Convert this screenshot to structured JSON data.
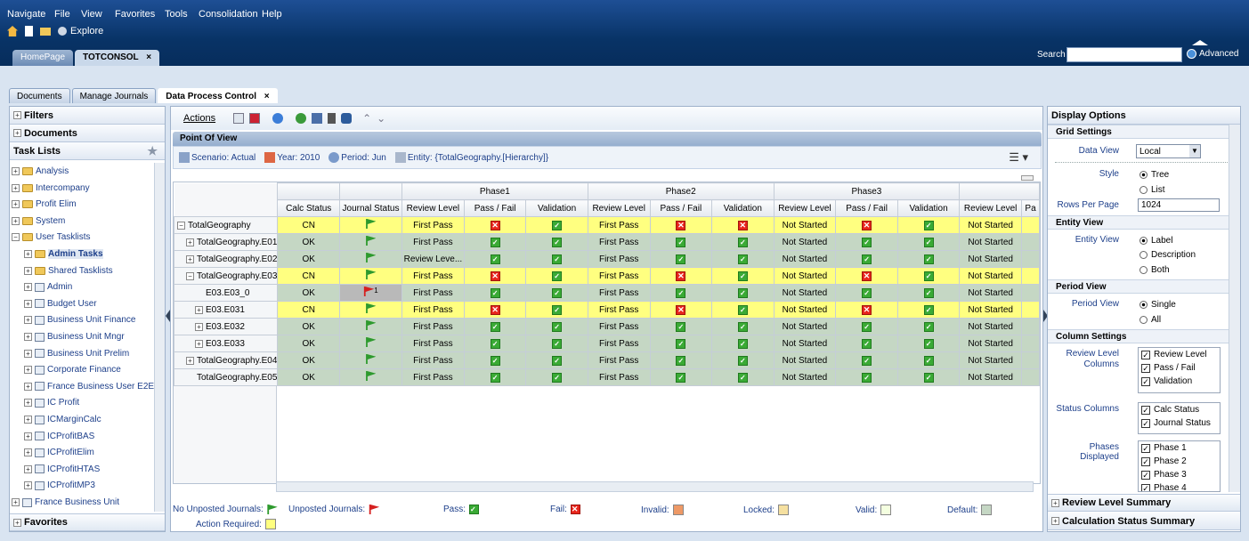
{
  "menu": [
    "Navigate",
    "File",
    "View",
    "Favorites",
    "Tools",
    "Consolidation",
    "Help"
  ],
  "toolbar": {
    "explore": "Explore"
  },
  "main_tabs": {
    "home": "HomePage",
    "active": "TOTCONSOL",
    "close": "×"
  },
  "search": {
    "label": "Search",
    "advanced": "Advanced"
  },
  "section_tabs": {
    "documents": "Documents",
    "manage": "Manage Journals",
    "active": "Data Process Control",
    "close": "×"
  },
  "left": {
    "filters": "Filters",
    "documents": "Documents",
    "task_lists": "Task Lists",
    "favorites": "Favorites",
    "tree": [
      {
        "label": "Analysis",
        "type": "folder",
        "level": 0
      },
      {
        "label": "Intercompany",
        "type": "folder",
        "level": 0
      },
      {
        "label": "Profit Elim",
        "type": "folder",
        "level": 0
      },
      {
        "label": "System",
        "type": "folder",
        "level": 0
      },
      {
        "label": "User Tasklists",
        "type": "folder",
        "level": 0
      },
      {
        "label": "Admin Tasks",
        "type": "folder",
        "level": 1
      },
      {
        "label": "Shared Tasklists",
        "type": "folder",
        "level": 1
      },
      {
        "label": "Admin",
        "type": "doc",
        "level": 1
      },
      {
        "label": "Budget User",
        "type": "doc",
        "level": 1
      },
      {
        "label": "Business Unit Finance",
        "type": "doc",
        "level": 1
      },
      {
        "label": "Business Unit Mngr",
        "type": "doc",
        "level": 1
      },
      {
        "label": "Business Unit Prelim",
        "type": "doc",
        "level": 1
      },
      {
        "label": "Corporate Finance",
        "type": "doc",
        "level": 1
      },
      {
        "label": "France Business User E2E",
        "type": "doc",
        "level": 1
      },
      {
        "label": "IC Profit",
        "type": "doc",
        "level": 1
      },
      {
        "label": "ICMarginCalc",
        "type": "doc",
        "level": 1
      },
      {
        "label": "ICProfitBAS",
        "type": "doc",
        "level": 1
      },
      {
        "label": "ICProfitElim",
        "type": "doc",
        "level": 1
      },
      {
        "label": "ICProfitHTAS",
        "type": "doc",
        "level": 1
      },
      {
        "label": "ICProfitMP3",
        "type": "doc",
        "level": 1
      },
      {
        "label": "France Business Unit",
        "type": "doc",
        "level": 0
      }
    ]
  },
  "center": {
    "actions": "Actions",
    "pov_title": "Point Of View",
    "pov": {
      "scenario": "Scenario: Actual",
      "year": "Year: 2010",
      "period": "Period: Jun",
      "entity": "Entity: {TotalGeography.[Hierarchy]}"
    },
    "phases": [
      "Phase1",
      "Phase2",
      "Phase3"
    ],
    "columns": {
      "calc": "Calc Status",
      "journal": "Journal Status",
      "review": "Review Level",
      "passfail": "Pass / Fail",
      "validation": "Validation",
      "partial": "Pa"
    },
    "rows": [
      {
        "name": "TotalGeography",
        "exp": "−",
        "ind": 0,
        "calc": "CN",
        "flag": "green",
        "color": "y",
        "p1": [
          "First Pass",
          "fail",
          "pass"
        ],
        "p2": [
          "First Pass",
          "fail",
          "fail"
        ],
        "p3": [
          "Not Started",
          "fail",
          "pass"
        ],
        "p4": "Not Started"
      },
      {
        "name": "TotalGeography.E01",
        "exp": "+",
        "ind": 1,
        "calc": "OK",
        "flag": "green",
        "color": "g",
        "p1": [
          "First Pass",
          "pass",
          "pass"
        ],
        "p2": [
          "First Pass",
          "pass",
          "pass"
        ],
        "p3": [
          "Not Started",
          "pass",
          "pass"
        ],
        "p4": "Not Started"
      },
      {
        "name": "TotalGeography.E02",
        "exp": "+",
        "ind": 1,
        "calc": "OK",
        "flag": "green",
        "color": "g",
        "p1": [
          "Review Leve...",
          "pass",
          "pass"
        ],
        "p2": [
          "First Pass",
          "pass",
          "pass"
        ],
        "p3": [
          "Not Started",
          "pass",
          "pass"
        ],
        "p4": "Not Started"
      },
      {
        "name": "TotalGeography.E03",
        "exp": "−",
        "ind": 1,
        "calc": "CN",
        "flag": "green",
        "color": "y",
        "p1": [
          "First Pass",
          "fail",
          "pass"
        ],
        "p2": [
          "First Pass",
          "fail",
          "pass"
        ],
        "p3": [
          "Not Started",
          "fail",
          "pass"
        ],
        "p4": "Not Started"
      },
      {
        "name": "E03.E03_0",
        "exp": "",
        "ind": 2,
        "calc": "OK",
        "flag": "red",
        "flag_count": "1",
        "color": "g",
        "p1": [
          "First Pass",
          "pass",
          "pass"
        ],
        "p2": [
          "First Pass",
          "pass",
          "pass"
        ],
        "p3": [
          "Not Started",
          "pass",
          "pass"
        ],
        "p4": "Not Started"
      },
      {
        "name": "E03.E031",
        "exp": "+",
        "ind": 2,
        "calc": "CN",
        "flag": "green",
        "color": "y",
        "p1": [
          "First Pass",
          "fail",
          "pass"
        ],
        "p2": [
          "First Pass",
          "fail",
          "pass"
        ],
        "p3": [
          "Not Started",
          "fail",
          "pass"
        ],
        "p4": "Not Started"
      },
      {
        "name": "E03.E032",
        "exp": "+",
        "ind": 2,
        "calc": "OK",
        "flag": "green",
        "color": "g",
        "p1": [
          "First Pass",
          "pass",
          "pass"
        ],
        "p2": [
          "First Pass",
          "pass",
          "pass"
        ],
        "p3": [
          "Not Started",
          "pass",
          "pass"
        ],
        "p4": "Not Started"
      },
      {
        "name": "E03.E033",
        "exp": "+",
        "ind": 2,
        "calc": "OK",
        "flag": "green",
        "color": "g",
        "p1": [
          "First Pass",
          "pass",
          "pass"
        ],
        "p2": [
          "First Pass",
          "pass",
          "pass"
        ],
        "p3": [
          "Not Started",
          "pass",
          "pass"
        ],
        "p4": "Not Started"
      },
      {
        "name": "TotalGeography.E04",
        "exp": "+",
        "ind": 1,
        "calc": "OK",
        "flag": "green",
        "color": "g",
        "p1": [
          "First Pass",
          "pass",
          "pass"
        ],
        "p2": [
          "First Pass",
          "pass",
          "pass"
        ],
        "p3": [
          "Not Started",
          "pass",
          "pass"
        ],
        "p4": "Not Started"
      },
      {
        "name": "TotalGeography.E05",
        "exp": "",
        "ind": 1,
        "calc": "OK",
        "flag": "green",
        "color": "g",
        "p1": [
          "First Pass",
          "pass",
          "pass"
        ],
        "p2": [
          "First Pass",
          "pass",
          "pass"
        ],
        "p3": [
          "Not Started",
          "pass",
          "pass"
        ],
        "p4": "Not Started"
      }
    ],
    "legend": {
      "no_unposted": "No Unposted Journals:",
      "unposted": "Unposted Journals:",
      "pass": "Pass:",
      "fail": "Fail:",
      "invalid": "Invalid:",
      "locked": "Locked:",
      "valid": "Valid:",
      "default": "Default:",
      "action": "Action Required:"
    },
    "legend_colors": {
      "invalid": "#ee9966",
      "locked": "#f5e0a0",
      "valid": "#f4ffe0",
      "default": "#c5d7c4",
      "action": "#ffff80"
    }
  },
  "right": {
    "title": "Display Options",
    "grid_settings": "Grid Settings",
    "data_view_label": "Data View",
    "data_view_value": "Local",
    "style_label": "Style",
    "style_tree": "Tree",
    "style_list": "List",
    "rows_label": "Rows Per Page",
    "rows_value": "1024",
    "entity_view": "Entity View",
    "entity_view_label": "Entity View",
    "ev_label": "Label",
    "ev_desc": "Description",
    "ev_both": "Both",
    "period_view": "Period View",
    "period_view_label": "Period View",
    "pv_single": "Single",
    "pv_all": "All",
    "column_settings": "Column Settings",
    "review_cols_label": "Review Level Columns",
    "review_cols": [
      "Review Level",
      "Pass / Fail",
      "Validation"
    ],
    "status_cols_label": "Status Columns",
    "status_cols": [
      "Calc Status",
      "Journal Status"
    ],
    "phases_label": "Phases Displayed",
    "phases": [
      "Phase 1",
      "Phase 2",
      "Phase 3",
      "Phase 4"
    ],
    "review_summary": "Review Level Summary",
    "calc_summary": "Calculation Status Summary"
  }
}
